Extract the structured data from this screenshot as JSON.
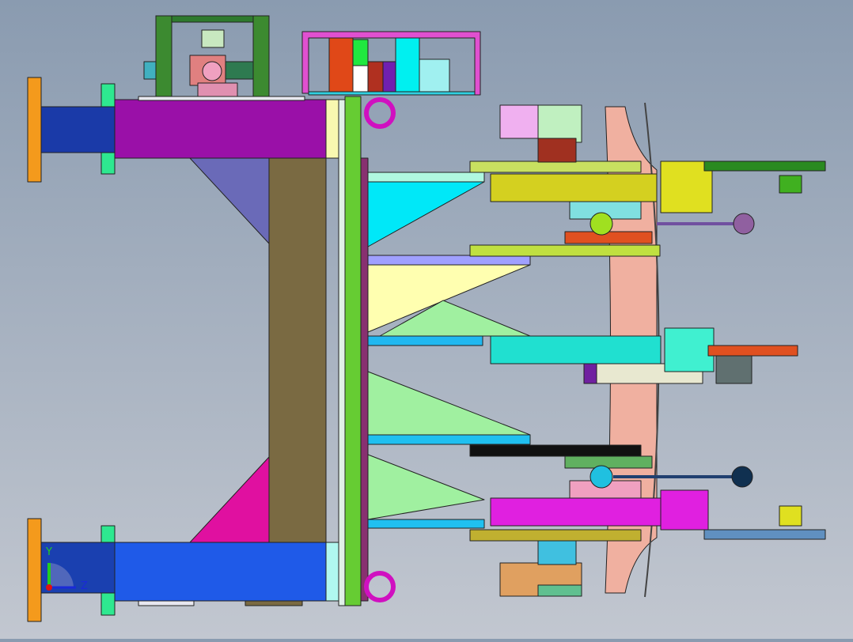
{
  "viewport": {
    "background_colors": [
      "#8a9bb0",
      "#c2c7d0"
    ]
  },
  "axis_triad": {
    "y_label": "Y",
    "z_label": "Z",
    "y_color": "#22cc22",
    "z_color": "#1a2ad8",
    "x_color": "#e01010"
  }
}
